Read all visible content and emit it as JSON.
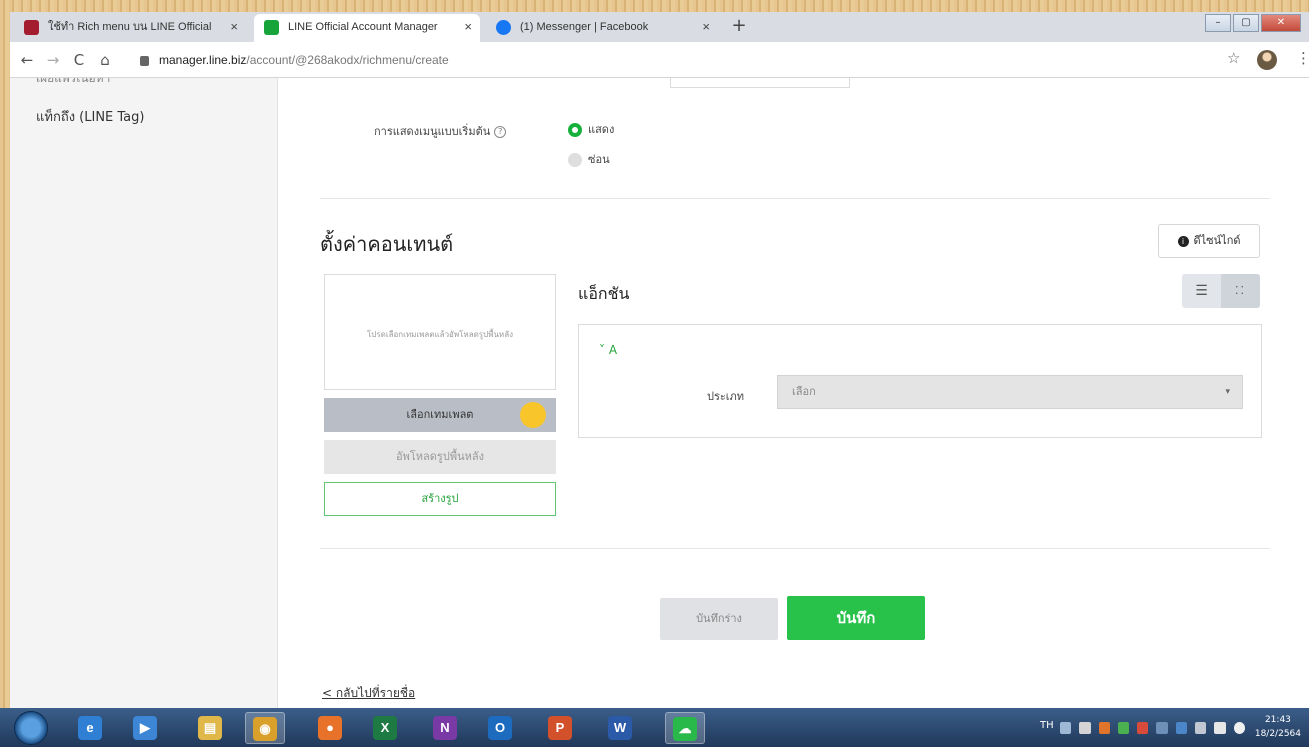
{
  "browser": {
    "tabs": [
      {
        "title": "ใช้ทำ Rich menu บน LINE Official",
        "active": false,
        "favicon_color": "#a31d2e"
      },
      {
        "title": "LINE Official Account Manager",
        "active": true,
        "favicon_color": "#17a43a"
      },
      {
        "title": "(1) Messenger | Facebook",
        "active": false,
        "favicon_color": "#1877f2"
      }
    ],
    "close_glyph": "×",
    "new_tab": "+",
    "window_controls": [
      "–",
      "▢",
      "✕"
    ],
    "back": "←",
    "forward": "→",
    "reload": "C",
    "home": "⌂",
    "url_host": "manager.line.biz",
    "url_path": "/account/@268akodx/richmenu/create",
    "star": "☆",
    "menu": "⋮"
  },
  "sidebar": {
    "cut_item": "เผยแพร่เนื้อหา",
    "item": "แท็กถึง (LINE Tag)"
  },
  "display": {
    "label": "การแสดงเมนูแบบเริ่มต้น",
    "help": "?",
    "options": [
      {
        "label": "แสดง",
        "selected": true
      },
      {
        "label": "ซ่อน",
        "selected": false
      }
    ]
  },
  "content": {
    "title": "ตั้งค่าคอนเทนต์",
    "guide_button": "ดีไซน์ไกด์",
    "guide_info": "i",
    "preview_hint": "โปรดเลือกเทมเพลตแล้วอัพโหลดรูปพื้นหลัง",
    "template_button": "เลือกเทมเพลต",
    "upload_button": "อัพโหลดรูปพื้นหลัง",
    "create_button": "สร้างรูป"
  },
  "action": {
    "title": "แอ็กชัน",
    "view_list_icon": "☰",
    "view_grid_icon": "⁚⁚",
    "area": "˅ A",
    "type_label": "ประเภท",
    "type_value": "เลือก",
    "type_chevron": "▾"
  },
  "footer": {
    "draft_button": "บันทึกร่าง",
    "save_button": "บันทึก",
    "back_link": "< กลับไปที่รายชื่อ"
  },
  "taskbar": {
    "apps": [
      {
        "name": "ie",
        "glyph": "e",
        "color": "#2f7fd4",
        "active": false
      },
      {
        "name": "media",
        "glyph": "▶",
        "color": "#3d86d6",
        "active": false
      },
      {
        "name": "explorer",
        "glyph": "▤",
        "color": "#e0b84a",
        "active": false
      },
      {
        "name": "chrome",
        "glyph": "◉",
        "color": "#d9a12c",
        "active": true
      },
      {
        "name": "firefox",
        "glyph": "●",
        "color": "#e8722a",
        "active": false
      },
      {
        "name": "excel",
        "glyph": "X",
        "color": "#1e7a43",
        "active": false
      },
      {
        "name": "onenote",
        "glyph": "N",
        "color": "#7a3aa6",
        "active": false
      },
      {
        "name": "outlook",
        "glyph": "O",
        "color": "#1c6bbf",
        "active": false
      },
      {
        "name": "powerpoint",
        "glyph": "P",
        "color": "#d2502a",
        "active": false
      },
      {
        "name": "word",
        "glyph": "W",
        "color": "#2b5aa8",
        "active": false
      },
      {
        "name": "line",
        "glyph": "☁",
        "color": "#29b94a",
        "active": true
      }
    ],
    "lang": "TH",
    "time": "21:43",
    "date": "18/2/2564"
  }
}
